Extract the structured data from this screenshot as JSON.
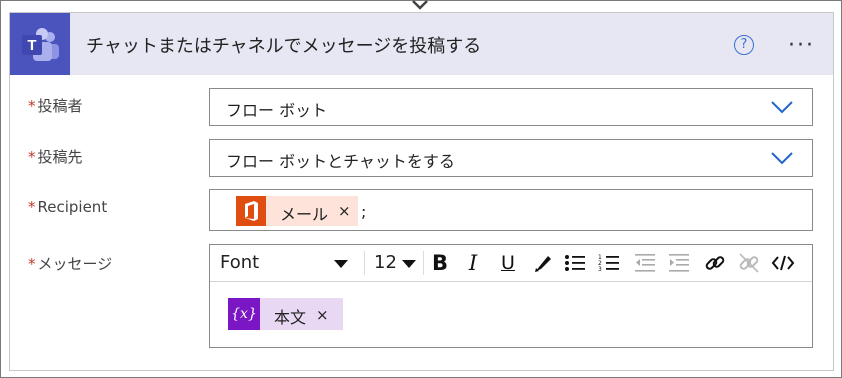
{
  "action": {
    "title": "チャットまたはチャネルでメッセージを投稿する",
    "help_icon": "?",
    "more_icon": "···",
    "logo_icon": "teams-logo"
  },
  "fields": [
    {
      "label": "投稿者",
      "required": "*",
      "value": "フロー ボット"
    },
    {
      "label": "投稿先",
      "required": "*",
      "value": "フロー ボットとチャットをする"
    },
    {
      "label": "Recipient",
      "required": "*",
      "token": "メール",
      "token_remove": "×",
      "separator": ";"
    },
    {
      "label": "メッセージ",
      "required": "*"
    }
  ],
  "editor": {
    "font": "Font",
    "size": "12",
    "bold": "B",
    "italic": "I",
    "underline": "U",
    "variable_icon": "{x}",
    "variable_token": "本文",
    "variable_remove": "×"
  },
  "colors": {
    "header_bg": "#e6e7f3",
    "teams_purple": "#4b53bc",
    "office_red": "#e04d10",
    "token_bg": "#fde3da",
    "variable_purple": "#7a16c3",
    "variable_bg": "#e9d8f4",
    "required_red": "#c0392b",
    "chevron_blue": "#2266cc"
  }
}
